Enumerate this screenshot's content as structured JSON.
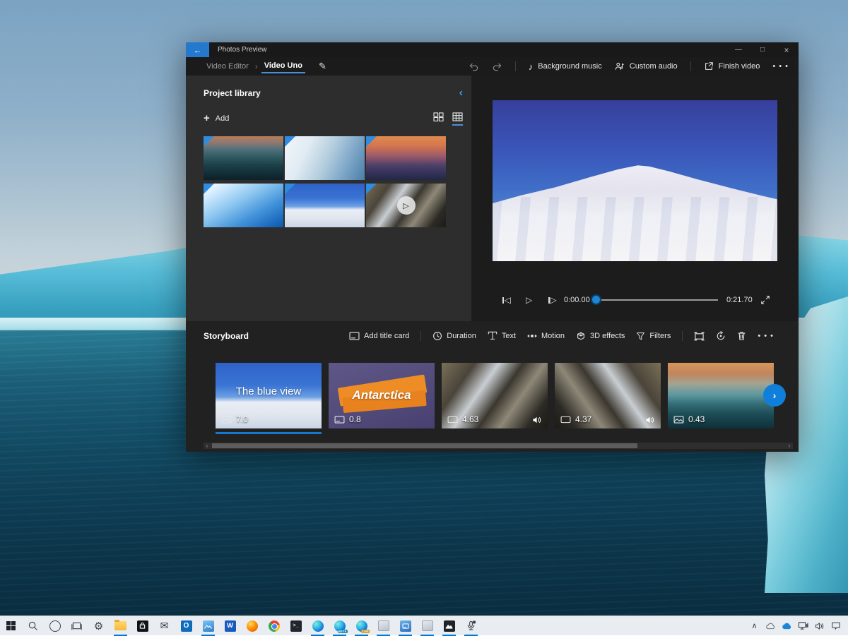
{
  "colors": {
    "accent": "#0078d7",
    "back_button": "#2479cf",
    "panel_bg": "#2d2d2d",
    "window_bg": "#1f1f1f",
    "storyboard_bg": "#212121",
    "taskbar_bg": "#e9edf2",
    "selection_blue": "#1677d0"
  },
  "glyphs": {
    "back": "←",
    "minimize": "—",
    "maximize": "□",
    "close": "×",
    "crumb_sep": "›",
    "pencil": "✎",
    "collapse": "‹",
    "plus": "+",
    "play": "▷",
    "prev": "◁",
    "next": "▷",
    "thumb_play": "▷",
    "more": "• • •",
    "next_arrow": "›",
    "scroll_left": "‹",
    "scroll_right": "›",
    "tray_chevron": "∧",
    "music_note": "♪"
  },
  "window": {
    "title": "Photos Preview",
    "breadcrumb": {
      "root": "Video Editor",
      "current": "Video Uno"
    },
    "top_toolbar": {
      "background_music": "Background music",
      "custom_audio": "Custom audio",
      "finish_video": "Finish video"
    },
    "project_library": {
      "title": "Project library",
      "add": "Add",
      "thumbnails": [
        {
          "name": "iceberg-sunset-dark",
          "type": "image"
        },
        {
          "name": "ice-closeup",
          "type": "image"
        },
        {
          "name": "iceberg-sunset-orange",
          "type": "image"
        },
        {
          "name": "blue-ice-flare",
          "type": "image"
        },
        {
          "name": "snow-mountain",
          "type": "image"
        },
        {
          "name": "rocky-waterfall",
          "type": "video"
        }
      ]
    },
    "preview": {
      "elapsed": "0:00.00",
      "total": "0:21.70"
    },
    "storyboard": {
      "title": "Storyboard",
      "add_title_card": "Add title card",
      "duration": "Duration",
      "text": "Text",
      "motion": "Motion",
      "effects": "3D effects",
      "filters": "Filters",
      "clips": [
        {
          "label": "The blue view",
          "duration": "7.0",
          "type": "image",
          "selected": true
        },
        {
          "label": "Antarctica",
          "duration": "0.8",
          "type": "title-card",
          "selected": false
        },
        {
          "label": "",
          "duration": "4.63",
          "type": "video",
          "selected": false
        },
        {
          "label": "",
          "duration": "4.37",
          "type": "video",
          "selected": false
        },
        {
          "label": "",
          "duration": "0.43",
          "type": "image",
          "selected": false
        }
      ]
    }
  },
  "taskbar": {
    "pinned": [
      "start",
      "search",
      "cortana",
      "task-view",
      "settings",
      "file-explorer",
      "store",
      "mail",
      "outlook",
      "photos",
      "word",
      "firefox",
      "chrome",
      "terminal",
      "edge",
      "edge-beta",
      "edge-canary",
      "app-light-1",
      "your-phone",
      "app-light-2",
      "photos-legacy",
      "voice-recorder"
    ],
    "open_apps": [
      "file-explorer",
      "photos",
      "edge",
      "edge-beta",
      "edge-canary",
      "app-light-1",
      "your-phone",
      "app-light-2",
      "photos-legacy",
      "voice-recorder"
    ],
    "edge_beta_badge": "BETA",
    "edge_canary_badge": "CAN",
    "word_letter": "W",
    "outlook_letter": "O",
    "terminal_glyph": ">_",
    "tray": [
      "hidden-icons",
      "onedrive",
      "onedrive-personal",
      "network",
      "volume",
      "action-center"
    ]
  }
}
